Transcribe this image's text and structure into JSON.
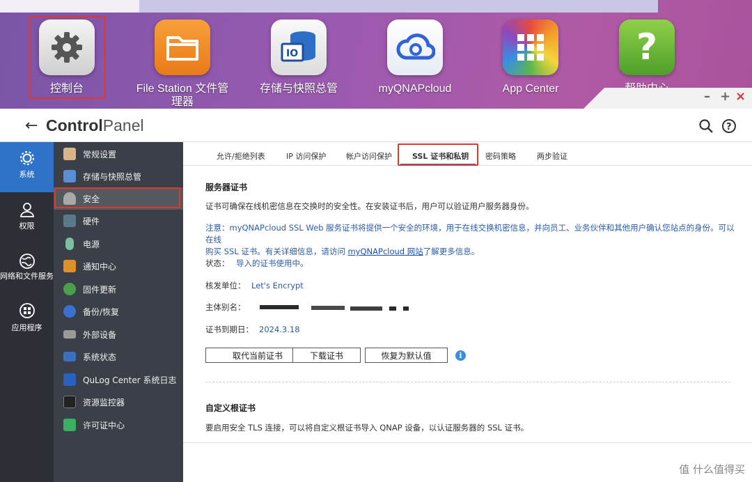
{
  "desktop": {
    "apps": [
      {
        "label": "控制台",
        "icon": "gear-icon"
      },
      {
        "label": "File Station 文件管理器",
        "icon": "folder-icon"
      },
      {
        "label": "存储与快照总管",
        "icon": "storage-icon"
      },
      {
        "label": "myQNAPcloud",
        "icon": "cloud-icon"
      },
      {
        "label": "App Center",
        "icon": "app-grid-icon"
      },
      {
        "label": "帮助中心",
        "icon": "help-icon"
      }
    ],
    "window_controls": {
      "minimize": "–",
      "maximize": "+",
      "close": "×"
    }
  },
  "window": {
    "title_bold": "Control",
    "title_light": "Panel",
    "left_nav": [
      {
        "label": "系统",
        "icon": "gear-icon",
        "active": true
      },
      {
        "label": "权限",
        "icon": "user-icon"
      },
      {
        "label": "网络和文件服务",
        "icon": "globe-icon"
      },
      {
        "label": "应用程序",
        "icon": "apps-icon"
      }
    ],
    "sub_nav": [
      {
        "label": "常规设置",
        "icon": "settings-doc-icon",
        "color": "#c98a3c"
      },
      {
        "label": "存储与快照总管",
        "icon": "storage-icon",
        "color": "#3a7fd0"
      },
      {
        "label": "安全",
        "icon": "lock-icon",
        "color": "#9a9a9a",
        "active": true
      },
      {
        "label": "硬件",
        "icon": "hardware-icon",
        "color": "#5a7a8a"
      },
      {
        "label": "电源",
        "icon": "power-icon",
        "color": "#7ac0a0"
      },
      {
        "label": "通知中心",
        "icon": "notification-icon",
        "color": "#e0902a"
      },
      {
        "label": "固件更新",
        "icon": "firmware-icon",
        "color": "#4aa04a"
      },
      {
        "label": "备份/恢复",
        "icon": "backup-icon",
        "color": "#3a70d0"
      },
      {
        "label": "外部设备",
        "icon": "external-device-icon",
        "color": "#8a8a8a"
      },
      {
        "label": "系统状态",
        "icon": "system-status-icon",
        "color": "#3a70c0"
      },
      {
        "label": "QuLog Center 系统日志",
        "icon": "qulog-icon",
        "color": "#2a60c0"
      },
      {
        "label": "资源监控器",
        "icon": "monitor-icon",
        "color": "#333333"
      },
      {
        "label": "许可证中心",
        "icon": "license-icon",
        "color": "#3ab060"
      }
    ],
    "tabs": [
      {
        "label": "允许/拒绝列表"
      },
      {
        "label": "IP 访问保护"
      },
      {
        "label": "帐户访问保护"
      },
      {
        "label": "SSL 证书和私钥",
        "active": true
      },
      {
        "label": "密码策略"
      },
      {
        "label": "两步验证"
      }
    ],
    "server_cert": {
      "title": "服务器证书",
      "desc": "证书可确保在线机密信息在交换时的安全性。在安装证书后，用户可以验证用户服务器身份。",
      "note_line1": "注意：myQNAPcloud SSL Web 服务证书将提供一个安全的环境，用于在线交换机密信息，并向员工、业务伙伴和其他用户确认您站点的身份。可以在线",
      "note_line2_pre": "购买 SSL 证书。有关详细信息，请访问 ",
      "note_link": "myQNAPcloud 网站",
      "note_line2_post": "了解更多信息。",
      "status_label": "状态：",
      "status_value": "导入的证书使用中。",
      "issuer_label": "核发单位：",
      "issuer_value": "Let's Encrypt",
      "alias_label": "主体别名：",
      "expiry_label": "证书到期日：",
      "expiry_value": "2024.3.18",
      "buttons": {
        "replace": "取代当前证书",
        "download": "下载证书",
        "restore": "恢复为默认值"
      }
    },
    "custom_root": {
      "title": "自定义根证书",
      "desc": "要启用安全 TLS 连接，可以将自定义根证书导入 QNAP 设备，以认证服务器的 SSL 证书。"
    }
  },
  "watermark": "值 什么值得买"
}
